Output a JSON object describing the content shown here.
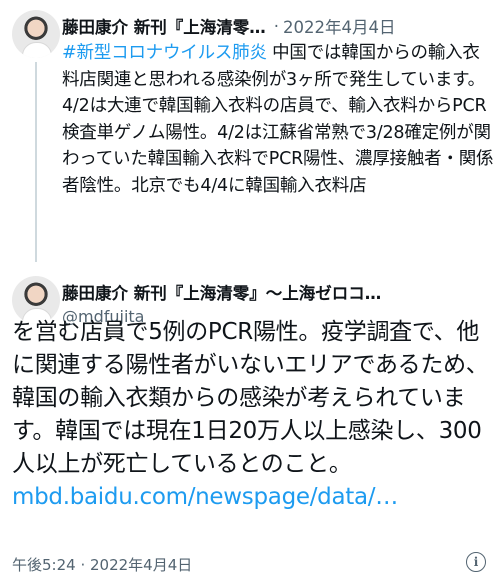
{
  "tweet1": {
    "author_name": "藤田康介 新刊『上海清零…",
    "separator": "·",
    "date": "2022年4月4日",
    "hashtag": "#新型コロナウイルス肺炎",
    "text": " 中国では韓国からの輸入衣料店関連と思われる感染例が3ヶ所で発生しています。4/2は大連で韓国輸入衣料の店員で、輸入衣料からPCR検査単ゲノム陽性。4/2は江蘇省常熟で3/28確定例が関わっていた韓国輸入衣料でPCR陽性、濃厚接触者・関係者陰性。北京でも4/4に韓国輸入衣料店"
  },
  "tweet2": {
    "author_name": "藤田康介 新刊『上海清零』〜上海ゼロコ…",
    "handle": "@mdfujita",
    "text": "を営む店員で5例のPCR陽性。疫学調査で、他に関連する陽性者がいないエリアであるため、韓国の輸入衣類からの感染が考えられています。韓国では現在1日20万人以上感染し、300人以上が死亡しているとのこと。",
    "link": "mbd.baidu.com/newspage/data/…",
    "timestamp": "午後5:24 · 2022年4月4日"
  },
  "icons": {
    "avatar": "avatar-photo",
    "info": "info-icon"
  },
  "colors": {
    "link": "#1d9bf0",
    "secondary_text": "#536471",
    "text": "#0f1419",
    "thread_line": "#cfd9de"
  }
}
